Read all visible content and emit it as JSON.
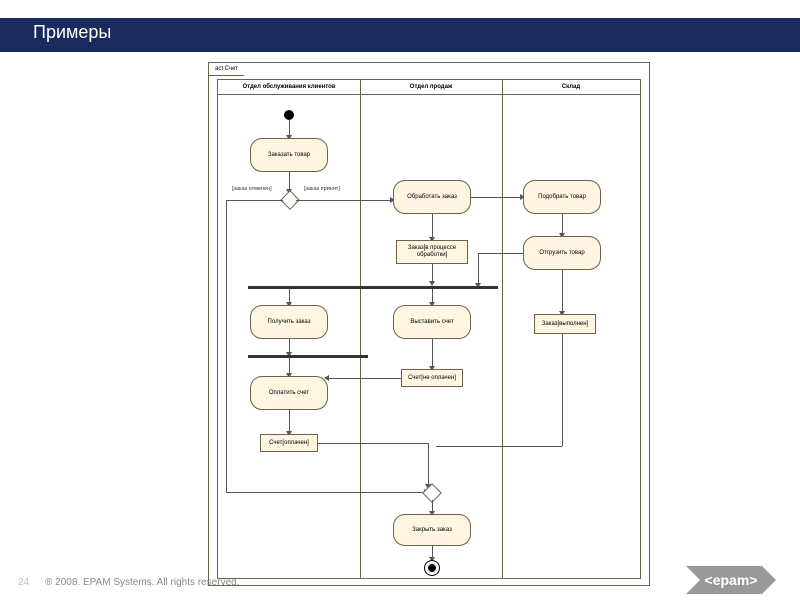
{
  "slide": {
    "title": "Примеры",
    "page_number": "24",
    "copyright": "® 2008. EPAM Systems. All rights reserved.",
    "logo_text": "<epam>"
  },
  "diagram": {
    "tab": "act Счет",
    "lanes": {
      "customer": "Отдел обслуживания клиентов",
      "sales": "Отдел продаж",
      "warehouse": "Склад"
    },
    "activities": {
      "order_goods": "Заказать товар",
      "process_order": "Обработать заказ",
      "pick_goods": "Подобрать товар",
      "ship_goods": "Отгрузить товар",
      "receive_order": "Получить заказ",
      "issue_invoice": "Выставить счет",
      "pay_invoice": "Оплатить счет",
      "close_order": "Закрыть заказ"
    },
    "objects": {
      "order_processing": "Заказ[в процессе обработки]",
      "order_done": "Заказ[выполнен]",
      "invoice_unpaid": "Счет[не оплачен]",
      "invoice_paid": "Счет[оплачен]"
    },
    "guards": {
      "rejected": "[заказ отменен]",
      "accepted": "[заказ принят]"
    }
  }
}
